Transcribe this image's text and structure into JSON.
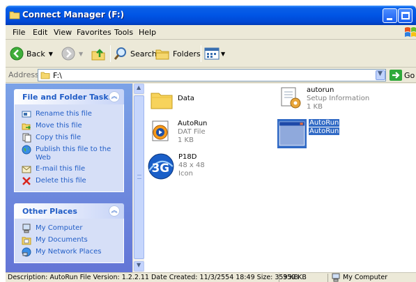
{
  "window": {
    "title": "Connect Manager (F:)"
  },
  "menu": {
    "items": [
      "File",
      "Edit",
      "View",
      "Favorites",
      "Tools",
      "Help"
    ]
  },
  "toolbar": {
    "back_label": "Back",
    "search_label": "Search",
    "folders_label": "Folders"
  },
  "address": {
    "label": "Address",
    "value": "F:\\",
    "go_label": "Go"
  },
  "tasks": {
    "file_folder": {
      "title": "File and Folder Tasks",
      "items": [
        {
          "label": "Rename this file",
          "icon": "rename-icon"
        },
        {
          "label": "Move this file",
          "icon": "move-icon"
        },
        {
          "label": "Copy this file",
          "icon": "copy-icon"
        },
        {
          "label": "Publish this file to the Web",
          "icon": "publish-web-icon"
        },
        {
          "label": "E-mail this file",
          "icon": "email-icon"
        },
        {
          "label": "Delete this file",
          "icon": "delete-icon"
        }
      ]
    },
    "other_places": {
      "title": "Other Places",
      "items": [
        {
          "label": "My Computer",
          "icon": "my-computer-icon"
        },
        {
          "label": "My Documents",
          "icon": "my-documents-icon"
        },
        {
          "label": "My Network Places",
          "icon": "network-places-icon"
        }
      ]
    }
  },
  "files": [
    {
      "name": "Data",
      "type": "",
      "size": "",
      "icon": "folder-icon"
    },
    {
      "name": "autorun",
      "type": "Setup Information",
      "size": "1 KB",
      "icon": "setup-info-icon"
    },
    {
      "name": "AutoRun",
      "type": "DAT File",
      "size": "1 KB",
      "icon": "media-player-icon"
    },
    {
      "name": "AutoRun",
      "type": "AutoRun",
      "size": "",
      "icon": "application-window-icon",
      "selected": true
    },
    {
      "name": "P18D",
      "type": "48 x 48",
      "size": "Icon",
      "icon": "3g-icon"
    }
  ],
  "status": {
    "description": "Description: AutoRun File Version: 1.2.2.11 Date Created: 11/3/2554 18:49 Size: 359 KB",
    "size": "359 KB",
    "location": "My Computer"
  },
  "colors": {
    "titlebar": "#0055e5",
    "task_link": "#215dc6",
    "selection": "#316ac5"
  }
}
